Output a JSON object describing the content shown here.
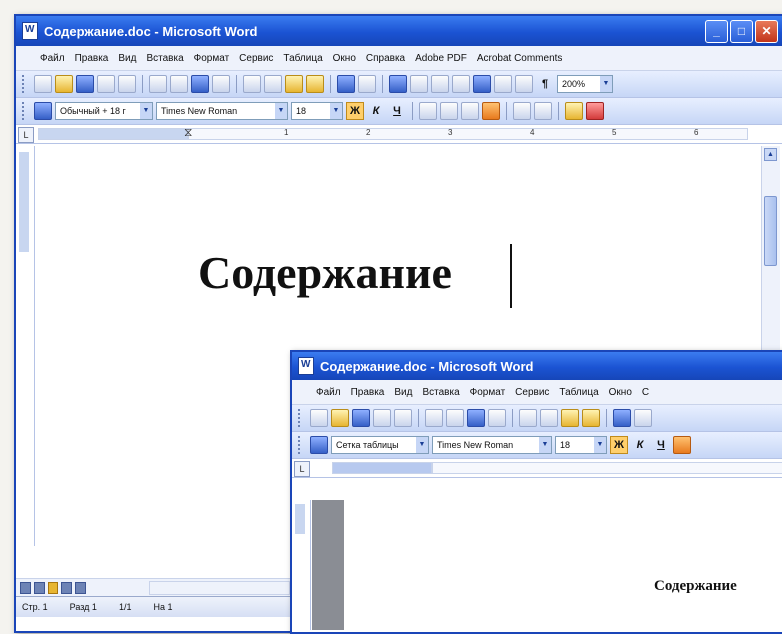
{
  "back_window": {
    "title": "Содержание.doc - Microsoft Word",
    "menu": [
      "Файл",
      "Правка",
      "Вид",
      "Вставка",
      "Формат",
      "Сервис",
      "Таблица",
      "Окно",
      "Справка",
      "Adobe PDF",
      "Acrobat Comments"
    ],
    "zoom": "200%",
    "style_value": "Обычный + 18 г",
    "font_value": "Times New Roman",
    "size_value": "18",
    "ruler_numbers": [
      "1",
      "2",
      "3",
      "4",
      "5",
      "6"
    ],
    "heading": "Содержание",
    "status": {
      "page": "Стр. 1",
      "section": "Разд 1",
      "pages": "1/1",
      "at": "На 1"
    }
  },
  "front_window": {
    "title": "Содержание.doc - Microsoft Word",
    "menu": [
      "Файл",
      "Правка",
      "Вид",
      "Вставка",
      "Формат",
      "Сервис",
      "Таблица",
      "Окно",
      "С"
    ],
    "style_value": "Сетка таблицы",
    "font_value": "Times New Roman",
    "size_value": "18",
    "heading": "Содержание"
  },
  "colors": {
    "titlebar": "#1b53d3",
    "toolbar": "#c6d6f6",
    "highlight": "#ffcf6b"
  }
}
